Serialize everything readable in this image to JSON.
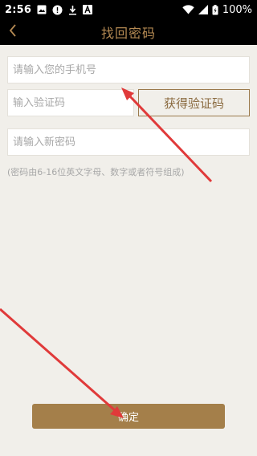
{
  "status_bar": {
    "time": "2:56",
    "battery": "100%",
    "icons": [
      "image-icon",
      "alert-icon",
      "download-icon",
      "a-icon",
      "wifi-icon",
      "signal-icon",
      "battery-icon"
    ]
  },
  "header": {
    "title": "找回密码",
    "back_icon": "chevron-left-icon"
  },
  "form": {
    "phone_placeholder": "请输入您的手机号",
    "code_placeholder": "输入验证码",
    "get_code_label": "获得验证码",
    "password_placeholder": "请输入新密码",
    "password_hint": "(密码由6-16位英文字母、数字或者符号组成)",
    "confirm_label": "确定"
  },
  "colors": {
    "accent": "#b58a53",
    "button": "#a47f4a",
    "background": "#f1efea",
    "annotation_arrow": "#e03a3a"
  }
}
